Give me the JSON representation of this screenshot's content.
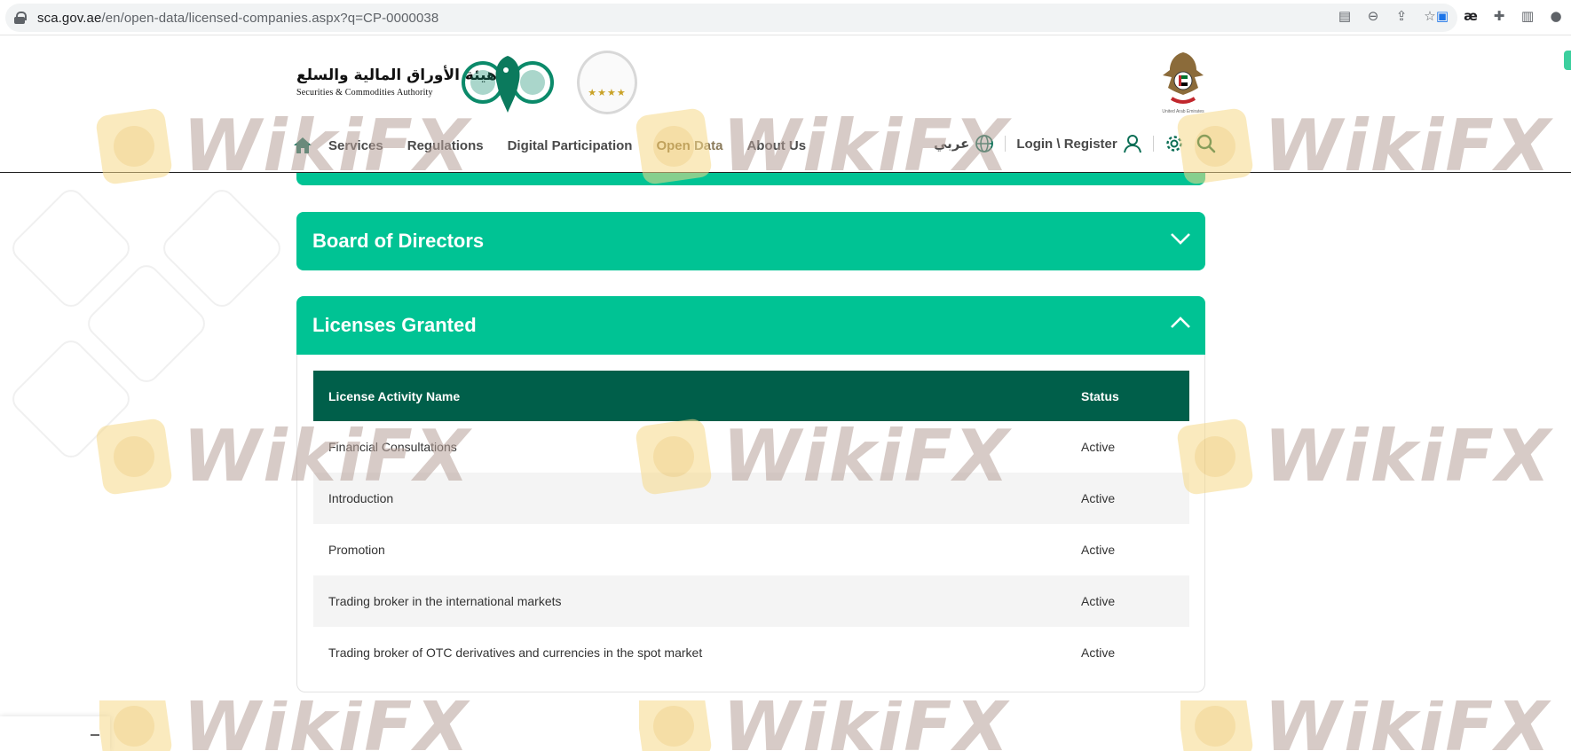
{
  "browser": {
    "url_host": "sca.gov.ae",
    "url_path": "/en/open-data/licensed-companies.aspx?q=CP-0000038"
  },
  "header": {
    "logo_arabic": "هيئة الأوراق المالية والسلع",
    "logo_english": "Securities & Commodities Authority",
    "uae_caption": "United Arab Emirates",
    "award_stars": "★★★★"
  },
  "nav": {
    "items": [
      {
        "label": "Services"
      },
      {
        "label": "Regulations"
      },
      {
        "label": "Digital Participation"
      },
      {
        "label": "Open Data",
        "active": true
      },
      {
        "label": "About Us"
      }
    ],
    "language": "عربي",
    "login": "Login \\ Register"
  },
  "sections": {
    "board": {
      "title": "Board of Directors"
    },
    "licenses": {
      "title": "Licenses Granted",
      "columns": {
        "name": "License Activity Name",
        "status": "Status"
      },
      "rows": [
        {
          "name": "Financial Consultations",
          "status": "Active"
        },
        {
          "name": "Introduction",
          "status": "Active"
        },
        {
          "name": "Promotion",
          "status": "Active"
        },
        {
          "name": "Trading broker in the international markets",
          "status": "Active"
        },
        {
          "name": "Trading broker of OTC derivatives and currencies in the spot market",
          "status": "Active"
        }
      ]
    }
  },
  "watermark": {
    "text": "WikiFX"
  },
  "colors": {
    "panel_green": "#00c394",
    "table_header": "#005f4a",
    "nav_text": "#4a4a4a",
    "icon_green": "#0b6e55"
  }
}
